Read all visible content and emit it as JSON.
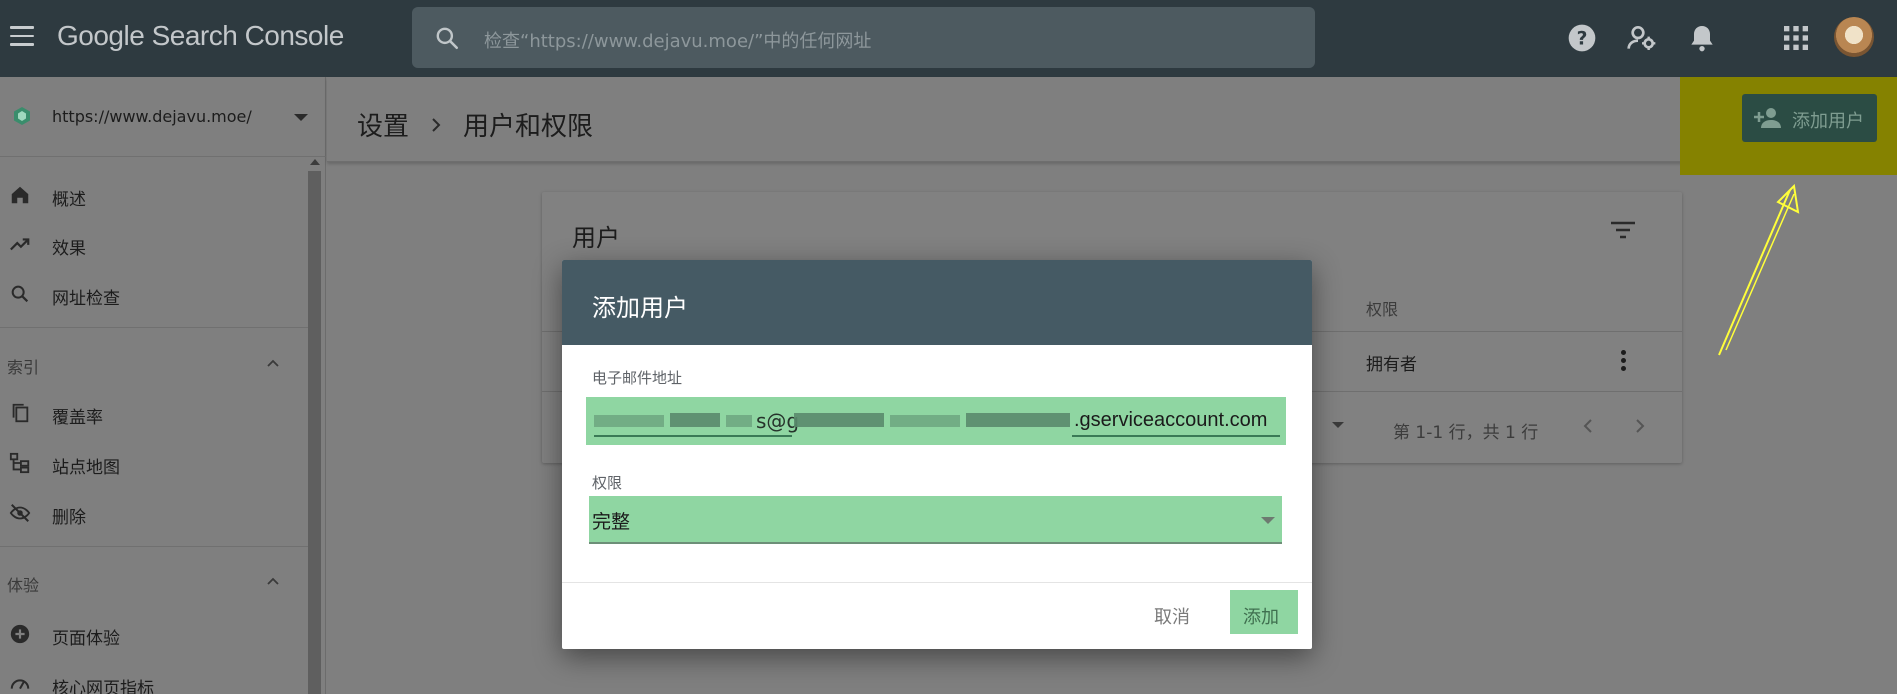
{
  "topbar": {
    "brand": "Google Search Console",
    "search_placeholder": "检查“https://www.dejavu.moe/”中的任何网址",
    "icons": [
      "menu-icon",
      "search-icon",
      "help-icon",
      "manage-users-icon",
      "notifications-icon",
      "apps-icon",
      "avatar"
    ]
  },
  "sidebar": {
    "property_url": "https://www.dejavu.moe/",
    "items": [
      {
        "label": "概述",
        "icon": "home-icon"
      },
      {
        "label": "效果",
        "icon": "trending-icon"
      },
      {
        "label": "网址检查",
        "icon": "search-icon"
      }
    ],
    "sections": [
      {
        "title": "索引",
        "items": [
          {
            "label": "覆盖率",
            "icon": "copy-icon"
          },
          {
            "label": "站点地图",
            "icon": "sitemap-icon"
          },
          {
            "label": "删除",
            "icon": "visibility-off-icon"
          }
        ]
      },
      {
        "title": "体验",
        "items": [
          {
            "label": "页面体验",
            "icon": "add-circle-icon"
          },
          {
            "label": "核心网页指标",
            "icon": "speed-icon"
          }
        ]
      }
    ]
  },
  "header": {
    "breadcrumb": [
      "设置",
      "用户和权限"
    ],
    "add_user_label": "添加用户"
  },
  "card": {
    "title": "用户",
    "column_permission": "权限",
    "row_permission": "拥有者",
    "pagination": "第 1-1 行，共 1 行"
  },
  "dialog": {
    "title": "添加用户",
    "email_label": "电子邮件地址",
    "email_visible_at": "s@g",
    "email_visible_suffix": ".gserviceaccount.com",
    "permission_label": "权限",
    "permission_value": "完整",
    "cancel_label": "取消",
    "add_label": "添加"
  },
  "colors": {
    "topbar": "#2e3a40",
    "dialog_header": "#455a64",
    "highlight_green": "#8fd6a2",
    "annotation_yellow": "#ffff00"
  }
}
